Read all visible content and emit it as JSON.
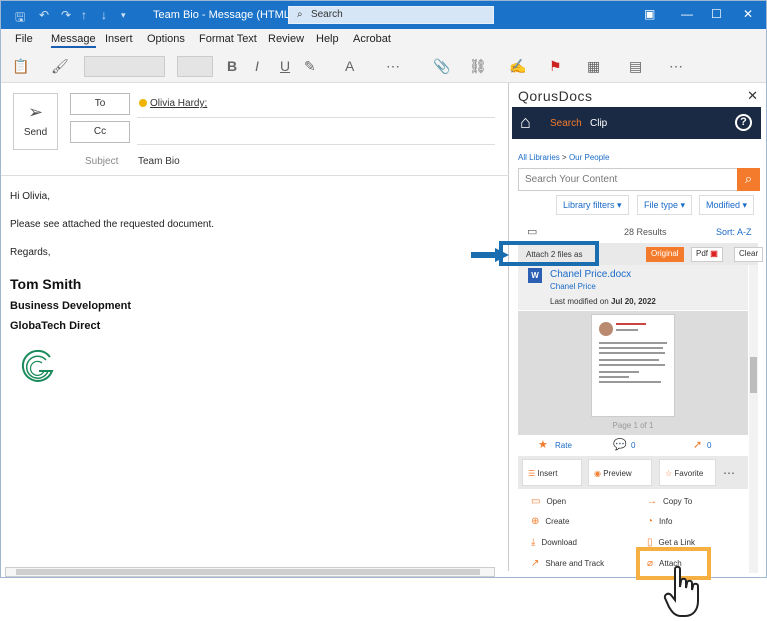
{
  "titlebar": {
    "title": "Team Bio  -  Message (HTML)",
    "search_placeholder": "Search"
  },
  "menu": [
    "File",
    "Message",
    "Insert",
    "Options",
    "Format Text",
    "Review",
    "Help",
    "Acrobat"
  ],
  "compose": {
    "send_label": "Send",
    "to_label": "To",
    "cc_label": "Cc",
    "to_value": "Olivia Hardy;",
    "subject_label": "Subject",
    "subject_value": "Team Bio"
  },
  "body": {
    "greeting": "Hi Olivia,",
    "text": "Please see attached the requested document.",
    "closing": "Regards,",
    "sig_name": "Tom Smith",
    "sig_title": "Business Development",
    "sig_company": "GlobaTech Direct"
  },
  "panel": {
    "title": "QorusDocs",
    "nav_search": "Search",
    "nav_clip": "Clip",
    "breadcrumb_root": "All Libraries",
    "breadcrumb_sep": ">",
    "breadcrumb_current": "Our People",
    "search_placeholder": "Search Your Content",
    "filters": [
      "Library filters",
      "File type",
      "Modified"
    ],
    "results": "28 Results",
    "sort": "Sort:  A-Z",
    "attach_label": "Attach 2 files as",
    "btn_original": "Original",
    "btn_pdf": "Pdf",
    "btn_clear": "Clear",
    "doc_name": "Chanel Price.docx",
    "doc_author": "Chanel Price",
    "doc_modified_prefix": "Last modified on",
    "doc_modified_date": "Jul 20, 2022",
    "page_of": "Page 1 of 1",
    "rate": "Rate",
    "comments": "0",
    "clicks": "0",
    "actions": [
      "Insert",
      "Preview",
      "Favorite"
    ],
    "menu_left": [
      "Open",
      "Create",
      "Download",
      "Share and Track"
    ],
    "menu_right": [
      "Copy To",
      "Info",
      "Get a Link",
      "Attach"
    ]
  },
  "colors": {
    "titlebar": "#1a73c8",
    "accent": "#f37b2b",
    "nav": "#1b2a44",
    "link": "#1a6bc8",
    "highlight_blue": "#1a6dae",
    "highlight_orange": "#f5b041"
  }
}
